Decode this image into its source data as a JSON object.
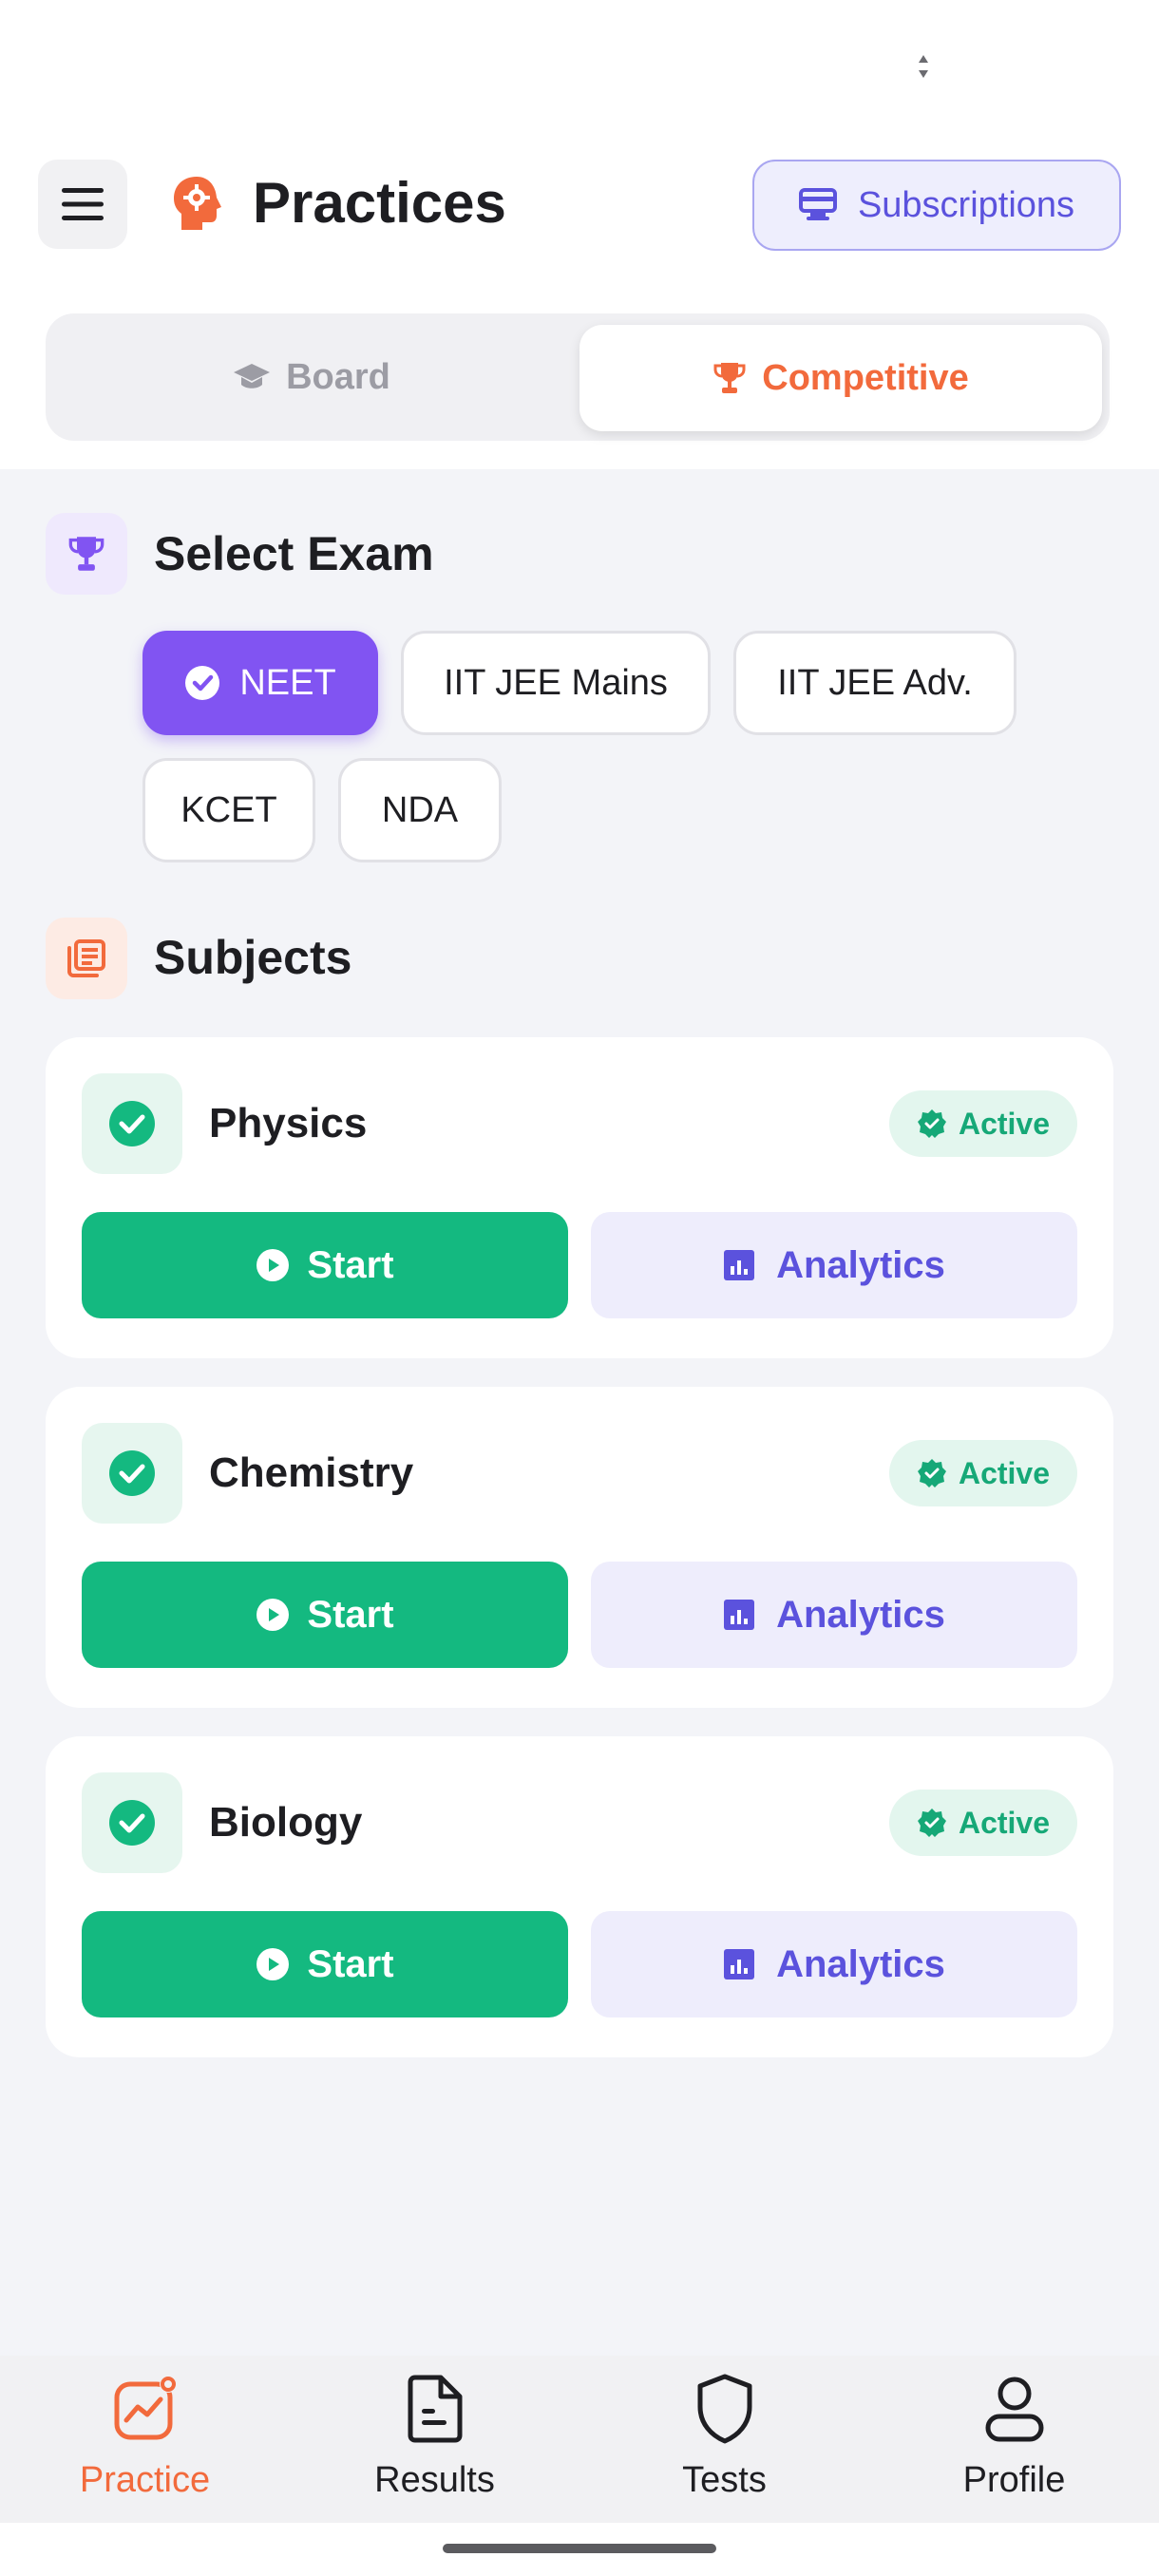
{
  "header": {
    "title": "Practices",
    "subscriptions_label": "Subscriptions"
  },
  "segment": {
    "board_label": "Board",
    "competitive_label": "Competitive",
    "selected": "Competitive"
  },
  "select_exam": {
    "title": "Select Exam",
    "exams": [
      "NEET",
      "IIT JEE Mains",
      "IIT JEE Adv.",
      "KCET",
      "NDA"
    ],
    "selected": "NEET"
  },
  "subjects": {
    "title": "Subjects",
    "items": [
      {
        "name": "Physics",
        "status": "Active",
        "start_label": "Start",
        "analytics_label": "Analytics"
      },
      {
        "name": "Chemistry",
        "status": "Active",
        "start_label": "Start",
        "analytics_label": "Analytics"
      },
      {
        "name": "Biology",
        "status": "Active",
        "start_label": "Start",
        "analytics_label": "Analytics"
      }
    ]
  },
  "bottom_nav": {
    "items": [
      {
        "label": "Practice",
        "icon": "practice-chart-icon",
        "active": true
      },
      {
        "label": "Results",
        "icon": "document-icon",
        "active": false
      },
      {
        "label": "Tests",
        "icon": "shield-icon",
        "active": false
      },
      {
        "label": "Profile",
        "icon": "user-icon",
        "active": false
      }
    ]
  },
  "colors": {
    "accent_orange": "#f26a3c",
    "accent_purple": "#8154f2",
    "accent_indigo": "#5b52dd",
    "success_green": "#14b980"
  }
}
